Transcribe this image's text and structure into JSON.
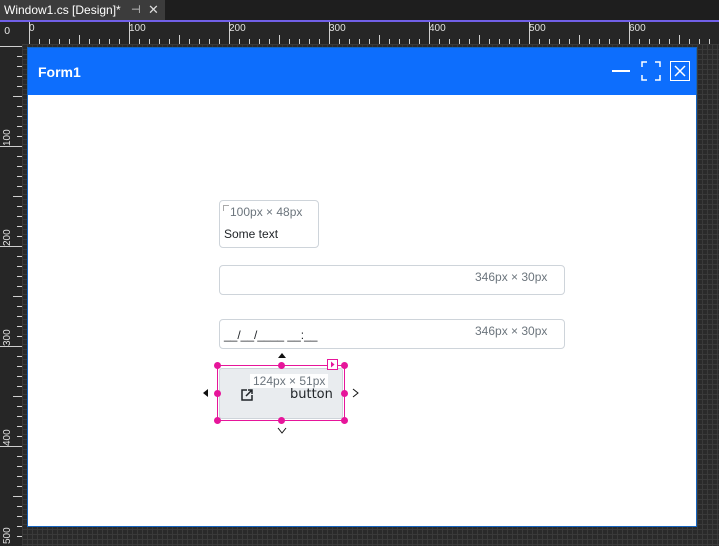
{
  "tab": {
    "title": "Window1.cs [Design]*",
    "pin_glyph": "⊣",
    "close_glyph": "✕"
  },
  "ruler": {
    "corner": "0",
    "top_labels": [
      "0",
      "100",
      "200",
      "300",
      "400",
      "500",
      "600"
    ],
    "left_labels": [
      "100",
      "200",
      "300",
      "400",
      "500"
    ]
  },
  "form": {
    "title": "Form1",
    "label": {
      "text": "Some text",
      "size": "100px × 48px"
    },
    "textbox": {
      "value": "",
      "size": "346px × 30px"
    },
    "masked": {
      "value": "__/__/____ __:__",
      "size": "346px × 30px"
    },
    "button": {
      "text": "button",
      "size": "124px × 51px"
    }
  },
  "colors": {
    "accent": "#0d6efd",
    "selection": "#e6159a",
    "tab_underline": "#7160e8"
  }
}
